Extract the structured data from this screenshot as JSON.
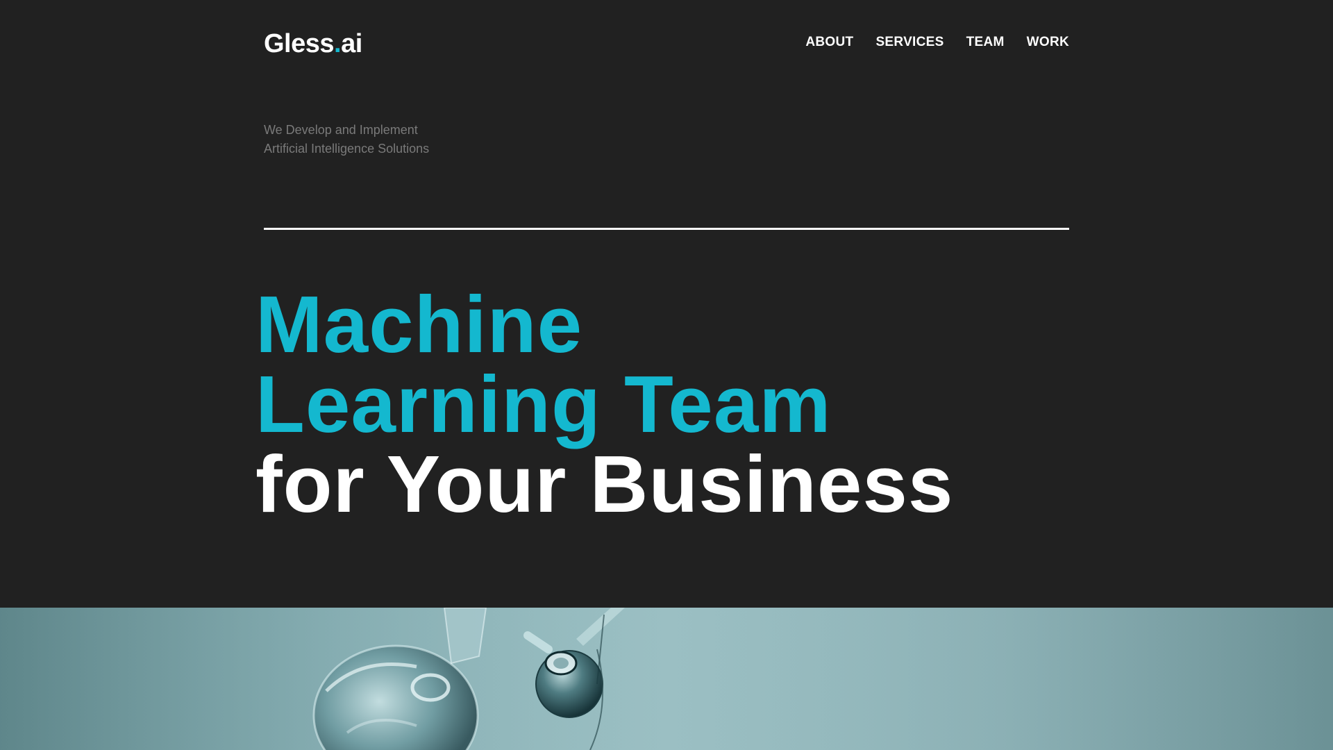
{
  "brand": {
    "name": "Gless",
    "dot": ".",
    "suffix": "ai",
    "accent_color": "#14b8cf"
  },
  "nav": {
    "items": [
      {
        "label": "ABOUT"
      },
      {
        "label": "SERVICES"
      },
      {
        "label": "TEAM"
      },
      {
        "label": "WORK"
      }
    ]
  },
  "tagline": {
    "line1": "We Develop and Implement",
    "line2": "Artificial Intelligence Solutions"
  },
  "hero": {
    "line1": "Machine",
    "line2": "Learning Team",
    "line3": "for Your Business"
  },
  "colors": {
    "background": "#212121",
    "accent": "#14b8cf",
    "text": "#ffffff",
    "muted": "#7a7a7a",
    "image_tint": "#8fb8bd"
  },
  "image": {
    "subject": "glass-flask-icon"
  }
}
